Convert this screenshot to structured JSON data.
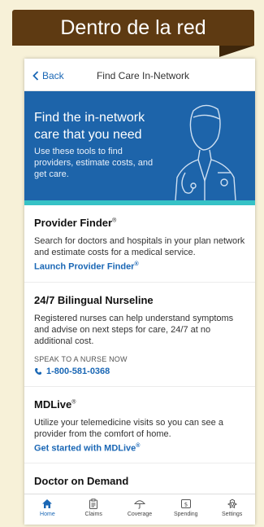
{
  "banner": {
    "title": "Dentro de la red"
  },
  "nav": {
    "back_label": "Back",
    "title": "Find Care In-Network"
  },
  "hero": {
    "heading": "Find the in-network care that you need",
    "body": "Use these tools to find providers, estimate costs, and get care."
  },
  "sections": [
    {
      "title": "Provider Finder",
      "mark": "®",
      "body": "Search for doctors and hospitals in your plan network and estimate costs for a medical service.",
      "link": "Launch Provider Finder",
      "link_mark": "®"
    },
    {
      "title": "24/7 Bilingual Nurseline",
      "body": "Registered nurses can help understand symptoms and advise on next steps for care, 24/7 at no additional cost.",
      "sub": "SPEAK TO A NURSE NOW",
      "phone": "1-800-581-0368"
    },
    {
      "title": "MDLive",
      "mark": "®",
      "body": "Utilize your telemedicine visits so you can see a provider from the comfort of home.",
      "link": "Get started with MDLive",
      "link_mark": "®"
    },
    {
      "title": "Doctor on Demand"
    }
  ],
  "tabs": [
    {
      "label": "Home",
      "icon": "home-icon",
      "active": true
    },
    {
      "label": "Claims",
      "icon": "clipboard-icon",
      "active": false
    },
    {
      "label": "Coverage",
      "icon": "umbrella-icon",
      "active": false
    },
    {
      "label": "Spending",
      "icon": "dollar-icon",
      "active": false
    },
    {
      "label": "Settings",
      "icon": "gear-icon",
      "active": false
    }
  ],
  "colors": {
    "brand_blue": "#1d64aa",
    "accent_teal": "#36c2c6",
    "banner_brown": "#5e3a12",
    "link_blue": "#1a67b5"
  }
}
